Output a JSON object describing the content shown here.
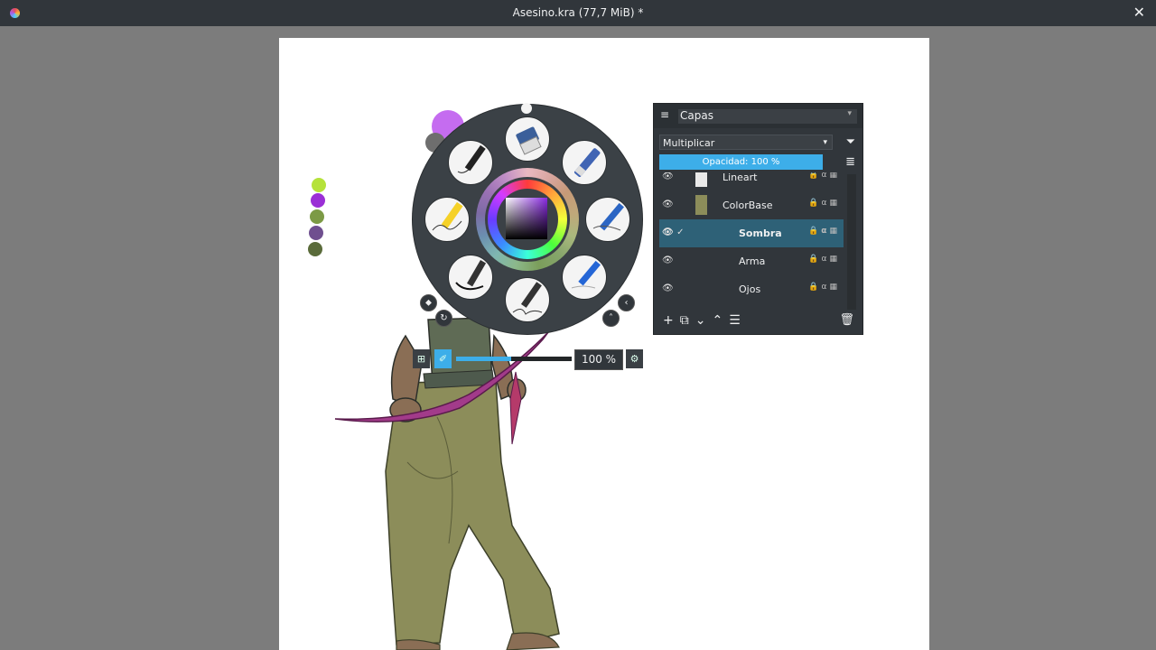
{
  "window": {
    "title": "Asesino.kra (77,7 MiB) *",
    "app_icon": "krita-icon",
    "close_glyph": "✕"
  },
  "colors": {
    "accent": "#3daee9",
    "foreground": "#c56cf0",
    "background": "#6e6e6e"
  },
  "recent_colors": [
    "#b5e23a",
    "#9b2fd6",
    "#7c9a45",
    "#6f4f8f",
    "#5a6b3a"
  ],
  "popup_palette": {
    "brushes": [
      "Ink pen",
      "Eraser",
      "Marker",
      "Pencil blue",
      "Pencil sketch",
      "Pen calligraphy",
      "Ink brush",
      "Marker yellow"
    ],
    "size_slider": {
      "value_label": "100 %",
      "fill_fraction": 0.48
    }
  },
  "layers_docker": {
    "title": "Capas",
    "blend_mode": "Multiplicar",
    "opacity_label": "Opacidad: 100 %",
    "layers": [
      {
        "name": "Lineart",
        "selected": false
      },
      {
        "name": "ColorBase",
        "selected": false
      },
      {
        "name": "Sombra",
        "selected": true
      },
      {
        "name": "Arma",
        "selected": false
      },
      {
        "name": "Ojos",
        "selected": false
      }
    ],
    "footer_icons": [
      "add-icon",
      "duplicate-icon",
      "move-down-icon",
      "move-up-icon",
      "properties-icon",
      "delete-icon"
    ]
  }
}
